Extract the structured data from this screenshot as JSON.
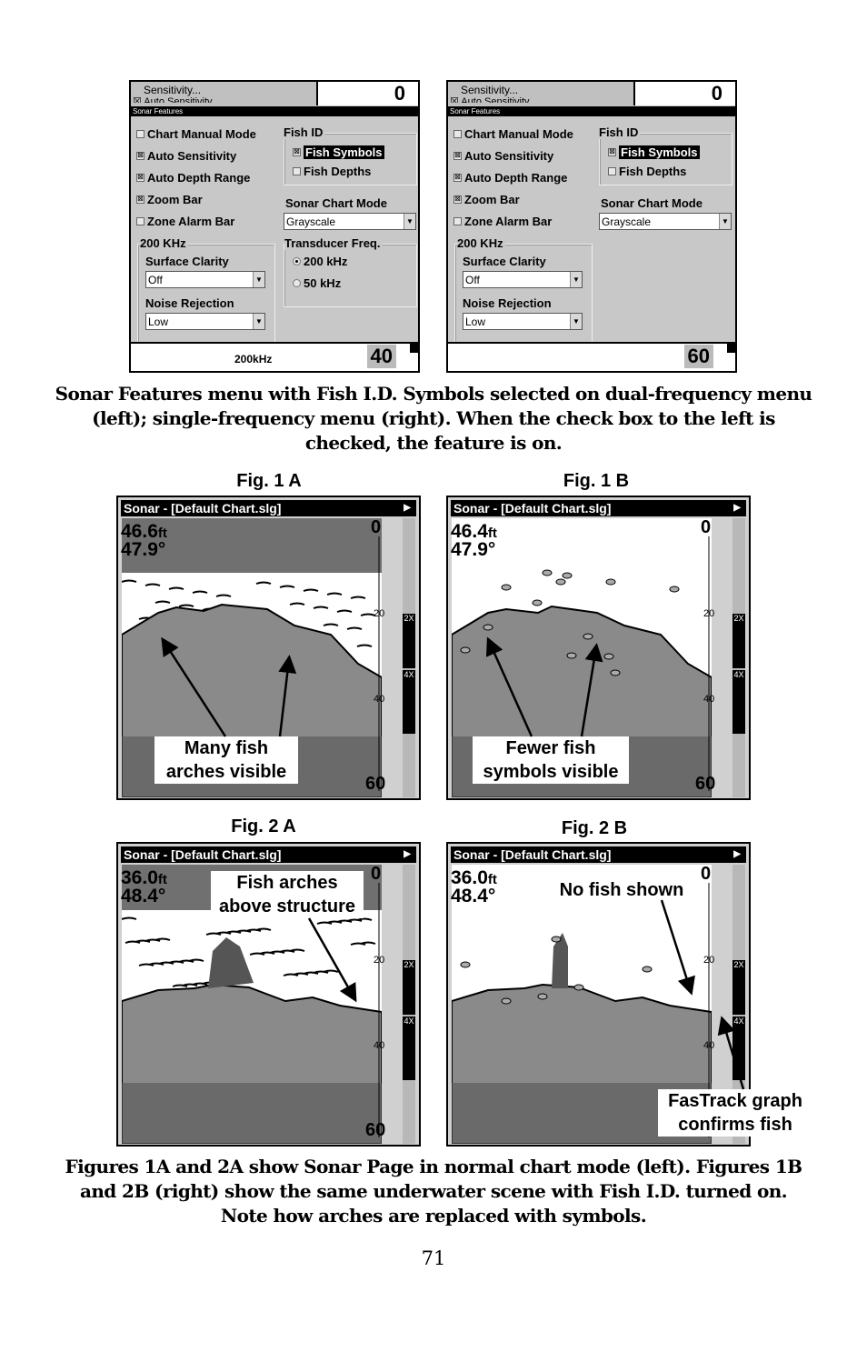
{
  "menus": [
    {
      "id": "dual",
      "top_label": "Sensitivity...",
      "top_sub": "☒ Auto Sensitivity",
      "scale_top": "0",
      "title": "Sonar Features",
      "options": [
        {
          "label": "Chart Manual Mode",
          "checked": false
        },
        {
          "label": "Auto Sensitivity",
          "checked": true
        },
        {
          "label": "Auto Depth Range",
          "checked": true
        },
        {
          "label": "Zoom Bar",
          "checked": true
        },
        {
          "label": "Zone Alarm Bar",
          "checked": false
        }
      ],
      "fish_id": {
        "label": "Fish ID",
        "symbols": "Fish Symbols",
        "symbols_checked": true,
        "depths": "Fish Depths",
        "depths_checked": false
      },
      "chart_mode": {
        "label": "Sonar Chart Mode",
        "value": "Grayscale"
      },
      "freq_group": {
        "label": "200 KHz",
        "surface_clarity": "Surface Clarity",
        "surface_value": "Off",
        "noise_rejection": "Noise Rejection",
        "noise_value": "Low"
      },
      "transducer": {
        "label": "Transducer Freq.",
        "options": [
          "200 kHz",
          "50 kHz"
        ],
        "selected": "200 kHz"
      },
      "footer_freq": "200kHz",
      "footer_depth": "40"
    },
    {
      "id": "single",
      "top_label": "Sensitivity...",
      "top_sub": "☒ Auto Sensitivity",
      "scale_top": "0",
      "title": "Sonar Features",
      "options": [
        {
          "label": "Chart Manual Mode",
          "checked": false
        },
        {
          "label": "Auto Sensitivity",
          "checked": true
        },
        {
          "label": "Auto Depth Range",
          "checked": true
        },
        {
          "label": "Zoom Bar",
          "checked": true
        },
        {
          "label": "Zone Alarm Bar",
          "checked": false
        }
      ],
      "fish_id": {
        "label": "Fish ID",
        "symbols": "Fish Symbols",
        "symbols_checked": true,
        "depths": "Fish Depths",
        "depths_checked": false
      },
      "chart_mode": {
        "label": "Sonar Chart Mode",
        "value": "Grayscale"
      },
      "freq_group": {
        "label": "200 KHz",
        "surface_clarity": "Surface Clarity",
        "surface_value": "Off",
        "noise_rejection": "Noise Rejection",
        "noise_value": "Low"
      },
      "footer_freq": "",
      "footer_depth": "60"
    }
  ],
  "caption_top": "Sonar Features menu with Fish I.D. Symbols selected on dual-frequency menu (left); single-frequency menu (right). When the check box to the left is checked, the feature is on.",
  "figures": [
    {
      "label": "Fig. 1 A",
      "title": "Sonar - [Default Chart.slg]",
      "depth": "46.6",
      "depth_unit": "ft",
      "temp": "47.9°",
      "scale_top": "0",
      "scale_mid1": "20",
      "scale_mid2": "40",
      "scale_bottom": "60",
      "zoom_2x": "2X",
      "zoom_4x": "4X",
      "callout": [
        "Many fish",
        "arches visible"
      ]
    },
    {
      "label": "Fig. 1 B",
      "title": "Sonar - [Default Chart.slg]",
      "depth": "46.4",
      "depth_unit": "ft",
      "temp": "47.9°",
      "scale_top": "0",
      "scale_mid1": "20",
      "scale_mid2": "40",
      "scale_bottom": "60",
      "zoom_2x": "2X",
      "zoom_4x": "4X",
      "callout": [
        "Fewer fish",
        "symbols visible"
      ]
    },
    {
      "label": "Fig. 2 A",
      "title": "Sonar - [Default Chart.slg]",
      "depth": "36.0",
      "depth_unit": "ft",
      "temp": "48.4°",
      "scale_top": "0",
      "scale_mid1": "20",
      "scale_mid2": "40",
      "scale_bottom": "60",
      "zoom_2x": "2X",
      "zoom_4x": "4X",
      "callout": [
        "Fish arches",
        "above structure"
      ]
    },
    {
      "label": "Fig. 2 B",
      "title": "Sonar - [Default Chart.slg]",
      "depth": "36.0",
      "depth_unit": "ft",
      "temp": "48.4°",
      "scale_top": "0",
      "scale_mid1": "20",
      "scale_mid2": "40",
      "scale_bottom": "",
      "zoom_2x": "2X",
      "zoom_4x": "4X",
      "callout": [
        "No fish shown"
      ],
      "callout2": [
        "FasTrack graph",
        "confirms fish"
      ]
    }
  ],
  "caption_bottom": "Figures 1A and 2A show Sonar Page in normal chart mode (left). Figures 1B and 2B (right) show the same underwater scene with Fish I.D. turned on. Note how arches are replaced with symbols.",
  "page_number": "71",
  "icons": {
    "checkbox_checked": "☒",
    "dropdown": "▼",
    "play": "▶"
  }
}
